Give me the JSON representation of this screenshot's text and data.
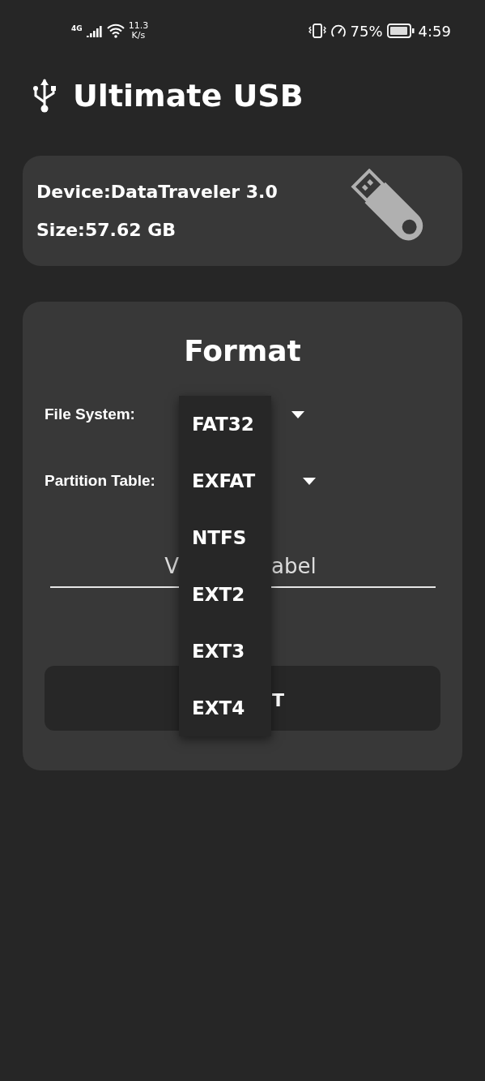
{
  "status_bar": {
    "network": "4G",
    "speed_value": "11.3",
    "speed_unit": "K/s",
    "battery": "75%",
    "time": "4:59"
  },
  "app": {
    "title": "Ultimate USB"
  },
  "device": {
    "name": "Device:DataTraveler 3.0",
    "size": "Size:57.62 GB"
  },
  "format": {
    "title": "Format",
    "selects": [
      {
        "label": "File System:"
      },
      {
        "label": "Partition Table:"
      }
    ],
    "volume_field": {
      "placeholder_visible": [
        "V",
        "abel"
      ]
    },
    "button_visible": "T",
    "menu": {
      "open": true,
      "items": [
        {
          "label": "FAT32"
        },
        {
          "label": "EXFAT"
        },
        {
          "label": "NTFS"
        },
        {
          "label": "EXT2"
        },
        {
          "label": "EXT3"
        },
        {
          "label": "EXT4"
        }
      ]
    }
  }
}
